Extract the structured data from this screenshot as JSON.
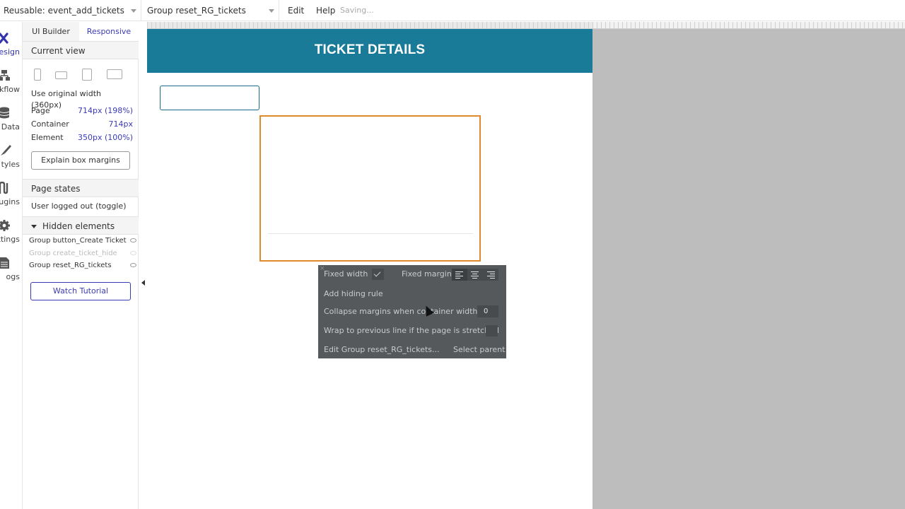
{
  "topbar": {
    "reusable_dropdown": "Reusable: event_add_tickets",
    "element_dropdown": "Group reset_RG_tickets",
    "menu_edit": "Edit",
    "menu_help": "Help",
    "status": "Saving..."
  },
  "leftnav": {
    "items": [
      {
        "label": "esign",
        "icon": "design-icon"
      },
      {
        "label": "rkflow",
        "icon": "workflow-icon"
      },
      {
        "label": "Data",
        "icon": "data-icon"
      },
      {
        "label": "tyles",
        "icon": "styles-icon"
      },
      {
        "label": "ugins",
        "icon": "plugins-icon"
      },
      {
        "label": "ttings",
        "icon": "settings-icon"
      },
      {
        "label": "ogs",
        "icon": "logs-icon"
      }
    ]
  },
  "panel": {
    "tab_ui_builder": "UI Builder",
    "tab_responsive": "Responsive",
    "current_view_title": "Current view",
    "use_original_width": "Use original width (360px)",
    "page_label": "Page",
    "page_value": "714px (198%)",
    "container_label": "Container",
    "container_value": "714px",
    "element_label": "Element",
    "element_value": "350px (100%)",
    "explain_button": "Explain box margins",
    "page_states_title": "Page states",
    "page_state_item": "User logged out (toggle)",
    "hidden_elements_title": "Hidden elements",
    "hidden_items": [
      "Group button_Create Ticket",
      "Group create_ticket_hide",
      "Group reset_RG_tickets"
    ],
    "watch_tutorial": "Watch Tutorial"
  },
  "canvas": {
    "header_title": "TICKET DETAILS"
  },
  "popup": {
    "close": "×",
    "fixed_width_label": "Fixed width",
    "fixed_width_checked": true,
    "fixed_margin_label": "Fixed margin",
    "add_hiding_rule": "Add hiding rule",
    "collapse_margins_label": "Collapse margins when container width ≤",
    "collapse_margins_value": "0",
    "wrap_label": "Wrap to previous line if the page is stretched",
    "wrap_checked": false,
    "edit_link": "Edit Group reset_RG_tickets...",
    "select_parent": "Select parent"
  },
  "colors": {
    "header": "#1a7b99",
    "selection_border": "#e08a2c",
    "accent_link": "#3a3ab5",
    "popup_bg": "#55595c"
  }
}
